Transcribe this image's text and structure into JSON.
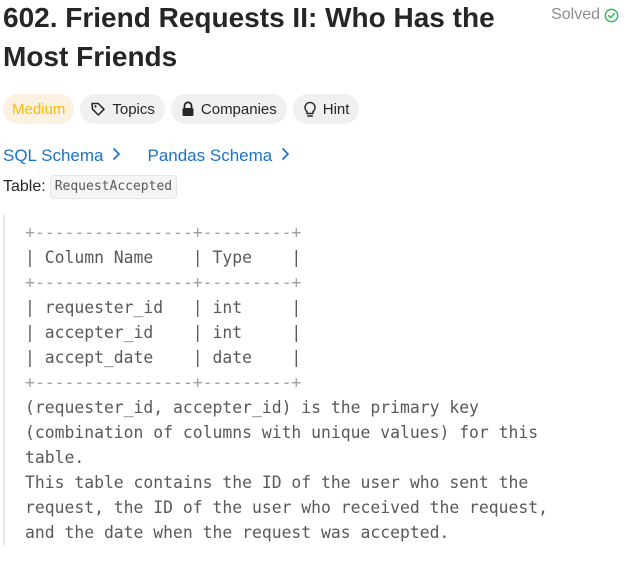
{
  "problem": {
    "title": "602. Friend Requests II: Who Has the Most Friends",
    "status": "Solved"
  },
  "tags": {
    "difficulty": "Medium",
    "topics": "Topics",
    "companies": "Companies",
    "hint": "Hint"
  },
  "schemas": {
    "sql": "SQL Schema",
    "pandas": "Pandas Schema"
  },
  "table": {
    "label": "Table:",
    "name": "RequestAccepted"
  },
  "schema_table": {
    "border": "+----------------+---------+",
    "header_row": "| Column Name    | Type    |",
    "rows": [
      "| requester_id   | int     |",
      "| accepter_id    | int     |",
      "| accept_date    | date    |"
    ]
  },
  "description": [
    "(requester_id, accepter_id) is the primary key",
    "(combination of columns with unique values) for this",
    "table.",
    "This table contains the ID of the user who sent the",
    "request, the ID of the user who received the request,",
    "and the date when the request was accepted."
  ],
  "colors": {
    "medium_text": "#ffb800",
    "medium_bg": "#fbf1e0",
    "solved_check": "#2cbb5d",
    "link": "#1a73c9"
  }
}
